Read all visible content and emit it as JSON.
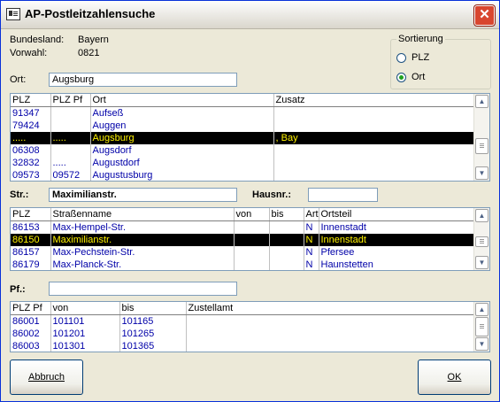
{
  "window": {
    "title": "AP-Postleitzahlensuche",
    "close_glyph": "✕"
  },
  "info": {
    "bundesland_label": "Bundesland:",
    "bundesland_value": "Bayern",
    "vorwahl_label": "Vorwahl:",
    "vorwahl_value": "0821"
  },
  "ort": {
    "label": "Ort:",
    "value": "Augsburg"
  },
  "sortierung": {
    "title": "Sortierung",
    "options": [
      {
        "label": "PLZ",
        "checked": false
      },
      {
        "label": "Ort",
        "checked": true
      }
    ]
  },
  "ort_table": {
    "headers": [
      "PLZ",
      "PLZ Pf",
      "Ort",
      "Zusatz"
    ],
    "rows": [
      [
        "91347",
        "",
        "Aufseß",
        ""
      ],
      [
        "79424",
        "",
        "Auggen",
        ""
      ],
      [
        ".....",
        ".....",
        "Augsburg",
        ", Bay"
      ],
      [
        "06308",
        "",
        "Augsdorf",
        ""
      ],
      [
        "32832",
        ".....",
        "Augustdorf",
        ""
      ],
      [
        "09573",
        "09572",
        "Augustusburg",
        ""
      ]
    ],
    "selected_index": 2
  },
  "strasse": {
    "label": "Str.:",
    "value": "Maximilianstr.",
    "hausnr_label": "Hausnr.:",
    "hausnr_value": ""
  },
  "street_table": {
    "headers": [
      "PLZ",
      "Straßenname",
      "von",
      "bis",
      "Art",
      "Ortsteil"
    ],
    "rows": [
      [
        "86153",
        "Max-Hempel-Str.",
        "",
        "",
        "N",
        "Innenstadt"
      ],
      [
        "86150",
        "Maximilianstr.",
        "",
        "",
        "N",
        "Innenstadt"
      ],
      [
        "86157",
        "Max-Pechstein-Str.",
        "",
        "",
        "N",
        "Pfersee"
      ],
      [
        "86179",
        "Max-Planck-Str.",
        "",
        "",
        "N",
        "Haunstetten"
      ]
    ],
    "selected_index": 1
  },
  "postfach": {
    "label": "Pf.:",
    "value": ""
  },
  "pf_table": {
    "headers": [
      "PLZ Pf",
      "von",
      "bis",
      "Zustellamt"
    ],
    "rows": [
      [
        "86001",
        "101101",
        "101165",
        ""
      ],
      [
        "86002",
        "101201",
        "101265",
        ""
      ],
      [
        "86003",
        "101301",
        "101365",
        ""
      ]
    ]
  },
  "buttons": {
    "abbruch": "Abbruch",
    "ok": "OK"
  },
  "icons": {
    "scroll_up": "▲",
    "scroll_down": "▼"
  },
  "colors": {
    "selection_bg": "#000000",
    "selection_fg": "#fff200",
    "cell_text": "#0000a8"
  }
}
